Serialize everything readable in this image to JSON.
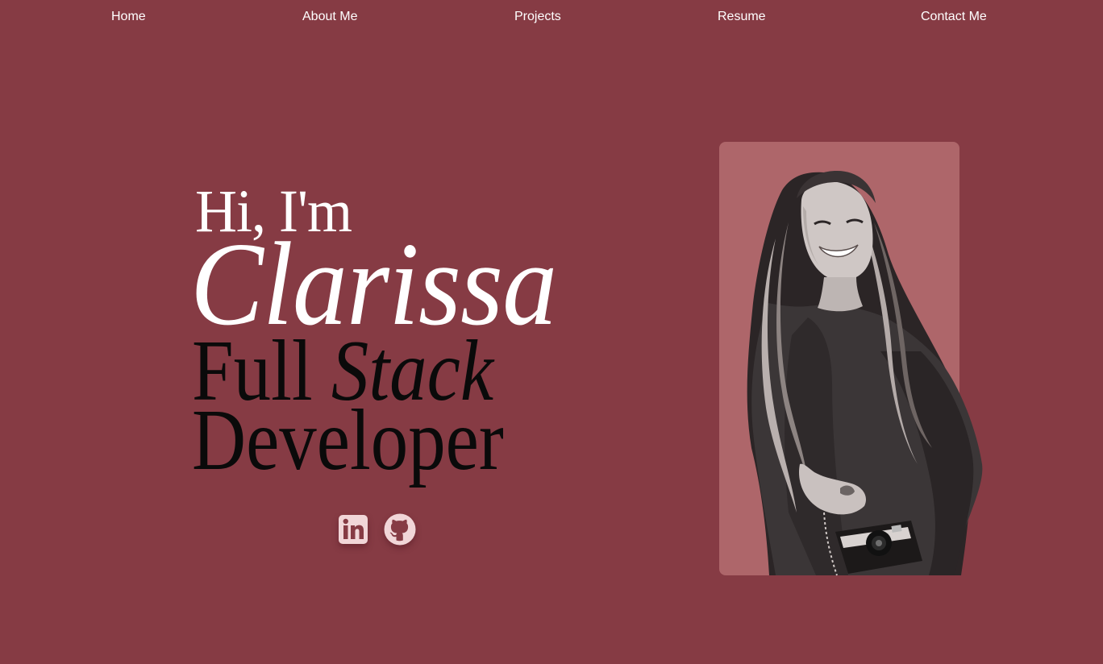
{
  "nav": {
    "items": [
      {
        "label": "Home"
      },
      {
        "label": "About Me"
      },
      {
        "label": "Projects"
      },
      {
        "label": "Resume"
      },
      {
        "label": "Contact Me"
      }
    ]
  },
  "hero": {
    "greeting": "Hi, I'm",
    "name": "Clarissa",
    "role_word1": "Full",
    "role_word2": "Stack",
    "role_line2": "Developer"
  },
  "socials": [
    {
      "icon": "linkedin-icon"
    },
    {
      "icon": "github-icon"
    }
  ],
  "colors": {
    "background": "#863b44",
    "card": "#ae666a",
    "nav_text": "#ffffff",
    "name_text": "#ffffff",
    "role_text": "#0a0a0a",
    "icon_fill": "#f1d6d8"
  }
}
